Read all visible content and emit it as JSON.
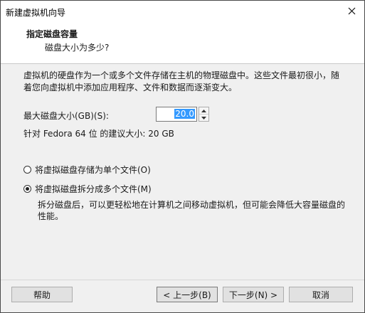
{
  "window": {
    "title": "新建虚拟机向导",
    "close_icon": "close-icon"
  },
  "header": {
    "title": "指定磁盘容量",
    "subtitle": "磁盘大小为多少?"
  },
  "description": "虚拟机的硬盘作为一个或多个文件存储在主机的物理磁盘中。这些文件最初很小，随着您向虚拟机中添加应用程序、文件和数据而逐渐变大。",
  "disk_size": {
    "label": "最大磁盘大小(GB)(S):",
    "value": "20.0"
  },
  "recommendation": "针对 Fedora 64 位 的建议大小: 20 GB",
  "options": {
    "single_file": {
      "label": "将虚拟磁盘存储为单个文件(O)",
      "selected": false
    },
    "multi_file": {
      "label": "将虚拟磁盘拆分成多个文件(M)",
      "selected": true
    },
    "multi_note": "拆分磁盘后，可以更轻松地在计算机之间移动虚拟机，但可能会降低大容量磁盘的性能。"
  },
  "buttons": {
    "help": "帮助",
    "back": "< 上一步(B)",
    "next": "下一步(N) >",
    "cancel": "取消"
  }
}
